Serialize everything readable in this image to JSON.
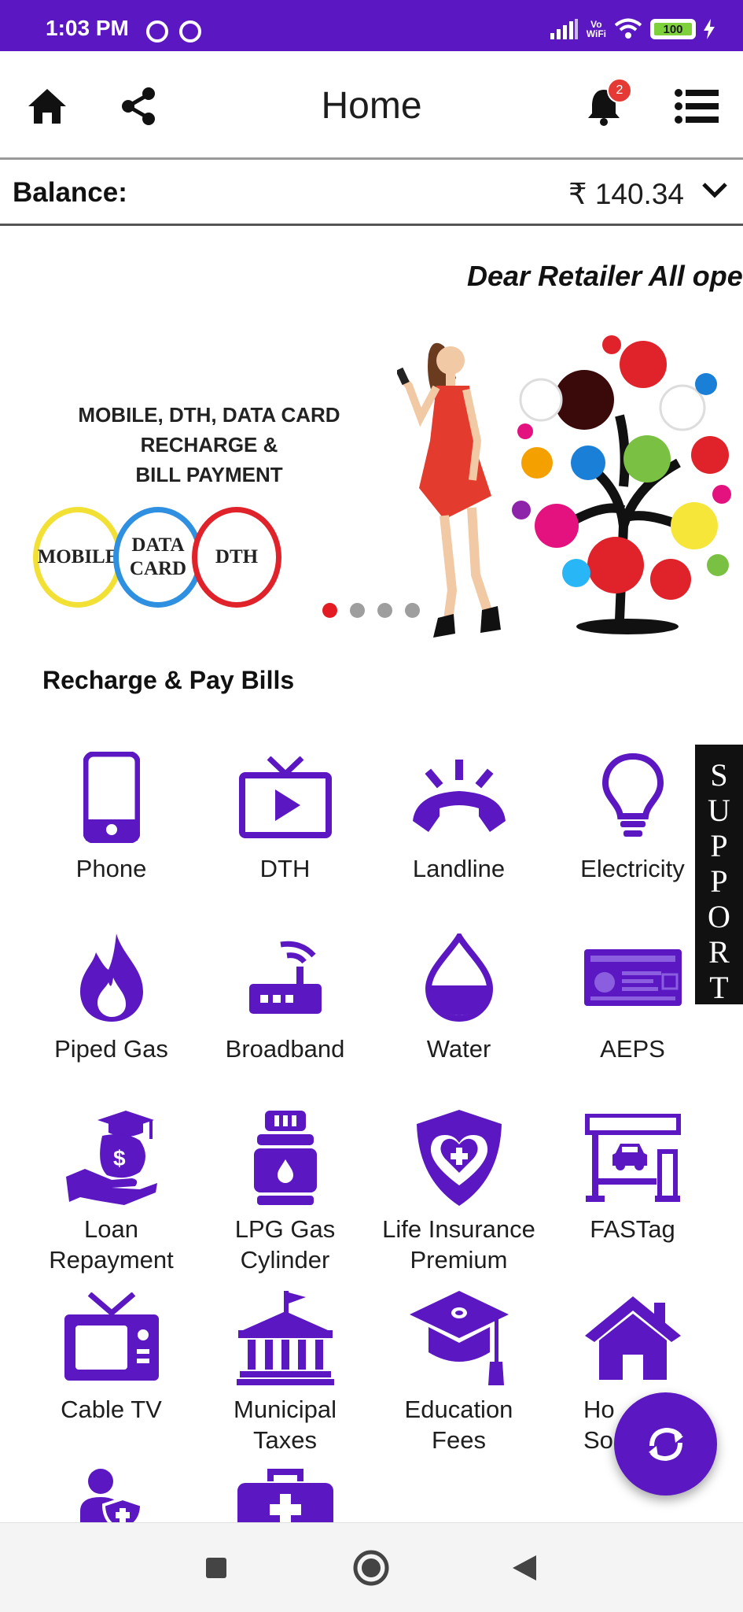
{
  "status_bar": {
    "time": "1:03 PM",
    "battery": "100",
    "network": "Vo\nWiFi"
  },
  "header": {
    "title": "Home",
    "notification_count": "2"
  },
  "balance": {
    "label": "Balance:",
    "value": "₹ 140.34"
  },
  "marquee": {
    "text": "Dear Retailer All oper"
  },
  "banner": {
    "headline": "MOBILE, DTH, DATA CARD RECHARGE  &\nBILL PAYMENT",
    "rings": [
      "MOBILE",
      "DATA\nCARD",
      "DTH"
    ],
    "slide_count": 4,
    "active_slide": 1
  },
  "section": {
    "title": "Recharge & Pay Bills"
  },
  "services": [
    {
      "label": "Phone",
      "icon": "phone-icon"
    },
    {
      "label": "DTH",
      "icon": "tv-play-icon"
    },
    {
      "label": "Landline",
      "icon": "landline-icon"
    },
    {
      "label": "Electricity",
      "icon": "bulb-icon"
    },
    {
      "label": "Piped Gas",
      "icon": "flame-icon"
    },
    {
      "label": "Broadband",
      "icon": "router-icon"
    },
    {
      "label": "Water",
      "icon": "water-drop-icon"
    },
    {
      "label": "AEPS",
      "icon": "aadhaar-card-icon"
    },
    {
      "label": "Loan\nRepayment",
      "icon": "loan-icon"
    },
    {
      "label": "LPG Gas\nCylinder",
      "icon": "gas-cylinder-icon"
    },
    {
      "label": "Life Insurance\nPremium",
      "icon": "insurance-shield-icon"
    },
    {
      "label": "FASTag",
      "icon": "toll-booth-icon"
    },
    {
      "label": "Cable TV",
      "icon": "cable-tv-icon"
    },
    {
      "label": "Municipal\nTaxes",
      "icon": "municipal-building-icon"
    },
    {
      "label": "Education\nFees",
      "icon": "graduation-cap-icon"
    },
    {
      "label": "Ho\nSo",
      "icon": "house-icon"
    },
    {
      "label": "",
      "icon": "health-insurance-icon"
    },
    {
      "label": "",
      "icon": "medical-kit-icon"
    }
  ],
  "support": {
    "label": "SUPPORT"
  },
  "colors": {
    "brand": "#5a17c2",
    "badge": "#e53935",
    "dot_active": "#e31b23"
  }
}
